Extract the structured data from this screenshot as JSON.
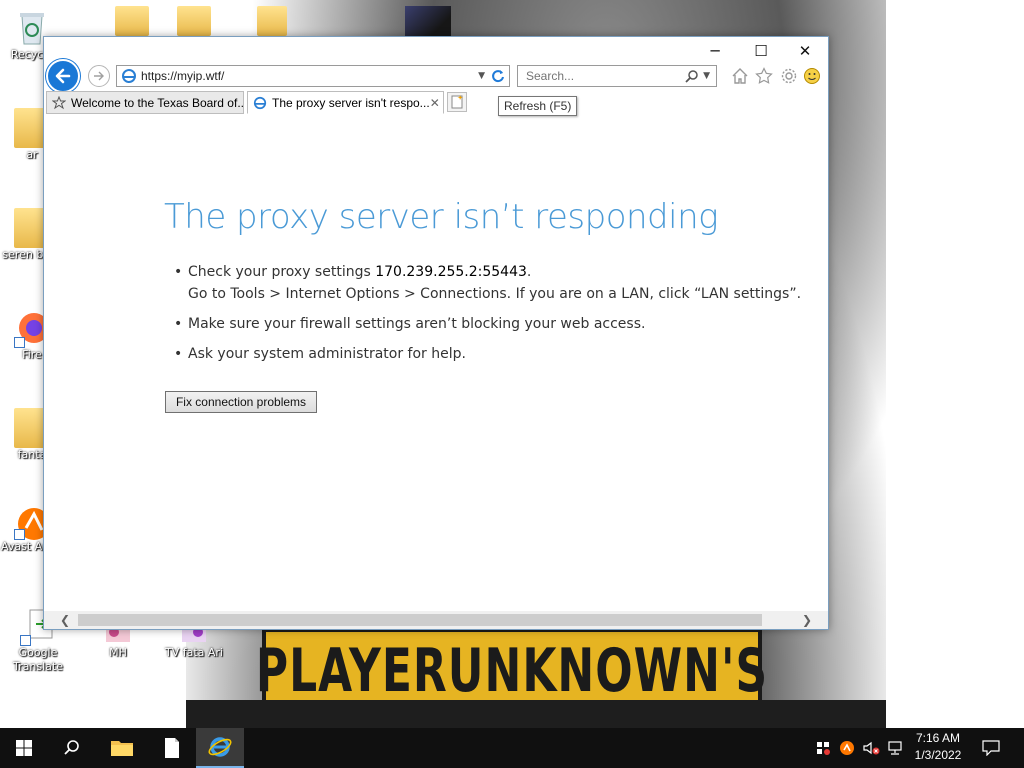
{
  "desktop": {
    "icons": [
      {
        "label": "Recycle"
      },
      {
        "label": "ar"
      },
      {
        "label": "seren brief"
      },
      {
        "label": "Fire"
      },
      {
        "label": "fanta"
      },
      {
        "label": "Avast Antiv"
      },
      {
        "label": "Google Translate"
      },
      {
        "label": "MH"
      },
      {
        "label": "TV fata Ari"
      }
    ],
    "wallpaper_text": "PLAYERUNKNOWN'S"
  },
  "browser": {
    "window_controls": {
      "minimize": "─",
      "maximize": "☐",
      "close": "✕"
    },
    "address_bar": {
      "url": "https://myip.wtf/"
    },
    "search_box": {
      "placeholder": "Search..."
    },
    "tabs": [
      {
        "title": "Welcome to the Texas Board of...",
        "active": false
      },
      {
        "title": "The proxy server isn't respo...",
        "active": true
      }
    ],
    "tooltip": "Refresh (F5)",
    "error_page": {
      "title": "The proxy server isn’t responding",
      "bullet1_prefix": "Check your proxy settings ",
      "proxy_address": "170.239.255.2:55443",
      "bullet1_suffix": ".",
      "bullet1_line2": "Go to Tools > Internet Options > Connections. If you are on a LAN, click “LAN settings”.",
      "bullet2": "Make sure your firewall settings aren’t blocking your web access.",
      "bullet3": "Ask your system administrator for help.",
      "fix_button": "Fix connection problems"
    }
  },
  "taskbar": {
    "clock": {
      "time": "7:16 AM",
      "date": "1/3/2022"
    }
  },
  "colors": {
    "accent": "#1a78d6",
    "error_title": "#4a9ad6",
    "taskbar": "#101010"
  }
}
